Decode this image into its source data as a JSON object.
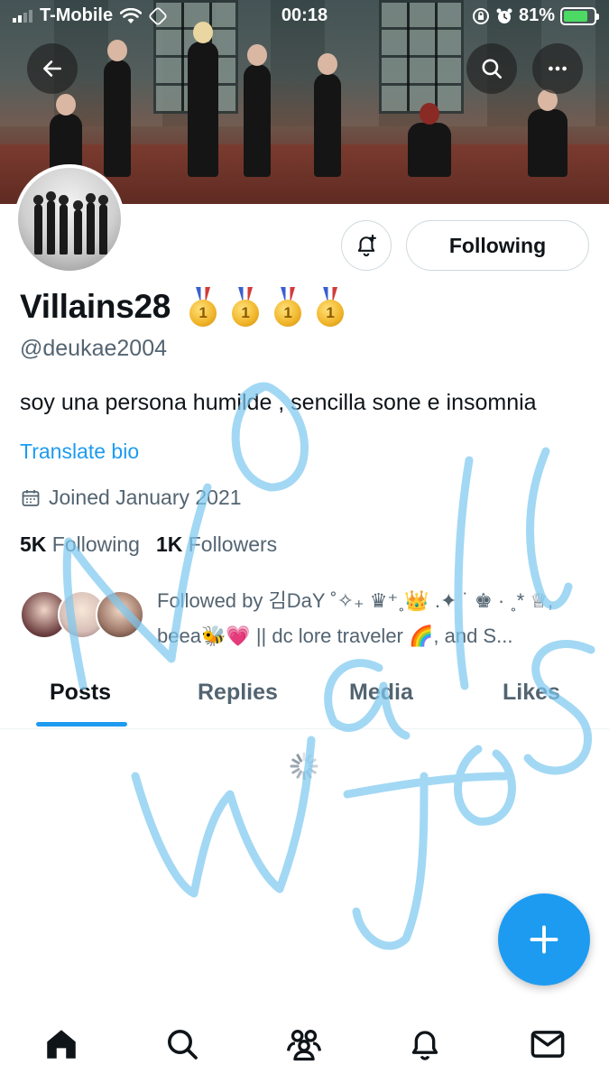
{
  "status_bar": {
    "carrier": "T-Mobile",
    "time": "00:18",
    "battery": "81%",
    "battery_level": 0.81
  },
  "profile": {
    "display_name": "Villains28",
    "badge_emojis": [
      "🥇",
      "🥇",
      "🥇",
      "🥇"
    ],
    "handle": "@deukae2004",
    "bio": "soy una persona humilde , sencilla sone e insomnia",
    "translate_label": "Translate bio",
    "joined": "Joined January 2021",
    "following_count": "5K",
    "following_label": "Following",
    "followers_count": "1K",
    "followers_label": "Followers",
    "followed_by_line1": "Followed by 김DaY ˚✧₊ ♛⁺˳👑 .✦ ˙ ♚ · ˳* ♕,",
    "followed_by_line2": "beea🐝💗 || dc lore traveler 🌈, and S..."
  },
  "actions": {
    "following_button": "Following"
  },
  "tabs": [
    {
      "label": "Posts",
      "active": true
    },
    {
      "label": "Replies",
      "active": false
    },
    {
      "label": "Media",
      "active": false
    },
    {
      "label": "Likes",
      "active": false
    }
  ],
  "watermark_text": "No Wall Jos",
  "icons": {
    "back": "back-arrow-icon",
    "search": "search-icon",
    "more": "more-icon",
    "notify": "bell-plus-icon",
    "calendar": "calendar-icon",
    "compose": "plus-icon",
    "nav": [
      "home-icon",
      "search-icon",
      "communities-icon",
      "notifications-icon",
      "messages-icon"
    ]
  },
  "colors": {
    "accent": "#1d9bf0",
    "text_primary": "#0f1419",
    "text_secondary": "#536471",
    "battery_fill": "#4cd964"
  }
}
